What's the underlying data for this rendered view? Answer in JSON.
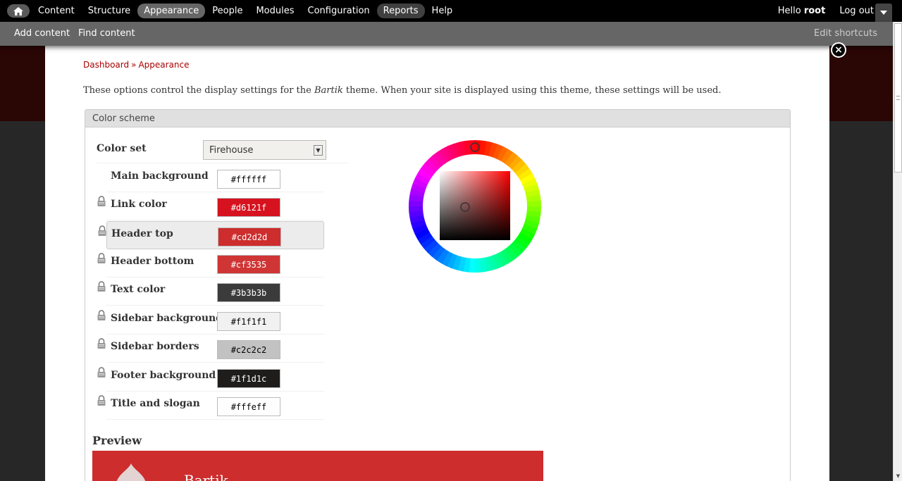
{
  "toolbar": {
    "home_icon": "home-icon",
    "menu": [
      {
        "label": "Content",
        "state": "normal"
      },
      {
        "label": "Structure",
        "state": "normal"
      },
      {
        "label": "Appearance",
        "state": "active"
      },
      {
        "label": "People",
        "state": "normal"
      },
      {
        "label": "Modules",
        "state": "normal"
      },
      {
        "label": "Configuration",
        "state": "normal"
      },
      {
        "label": "Reports",
        "state": "pill"
      },
      {
        "label": "Help",
        "state": "normal"
      }
    ],
    "hello": "Hello",
    "user": "root",
    "logout": "Log out",
    "drawer_icon": "chevron-down-icon"
  },
  "shortcuts": {
    "items": [
      "Add content",
      "Find content"
    ],
    "edit": "Edit shortcuts"
  },
  "overlay": {
    "close_symbol": "×",
    "breadcrumb": [
      "Dashboard",
      "Appearance"
    ],
    "breadcrumb_sep": "»",
    "intro_before": "These options control the display settings for the ",
    "intro_theme": "Bartik",
    "intro_after": " theme. When your site is displayed using this theme, these settings will be used.",
    "color_scheme": {
      "legend": "Color scheme",
      "color_set_label": "Color set",
      "color_set_value": "Firehouse",
      "fields": [
        {
          "label": "Main background",
          "value": "#ffffff",
          "bg": "#ffffff",
          "fg": "#000000",
          "lock": false
        },
        {
          "label": "Link color",
          "value": "#d6121f",
          "bg": "#d6121f",
          "fg": "#ffffff",
          "lock": true
        },
        {
          "label": "Header top",
          "value": "#cd2d2d",
          "bg": "#cd2d2d",
          "fg": "#ffffff",
          "lock": true
        },
        {
          "label": "Header bottom",
          "value": "#cf3535",
          "bg": "#cf3535",
          "fg": "#ffffff",
          "lock": true
        },
        {
          "label": "Text color",
          "value": "#3b3b3b",
          "bg": "#3b3b3b",
          "fg": "#ffffff",
          "lock": true
        },
        {
          "label": "Sidebar background",
          "value": "#f1f1f1",
          "bg": "#f1f1f1",
          "fg": "#000000",
          "lock": true
        },
        {
          "label": "Sidebar borders",
          "value": "#c2c2c2",
          "bg": "#c2c2c2",
          "fg": "#000000",
          "lock": true
        },
        {
          "label": "Footer background",
          "value": "#1f1d1c",
          "bg": "#1f1d1c",
          "fg": "#ffffff",
          "lock": true
        },
        {
          "label": "Title and slogan",
          "value": "#fffeff",
          "bg": "#fffeff",
          "fg": "#000000",
          "lock": true
        }
      ],
      "selected_field": "Header top"
    },
    "preview": {
      "title": "Preview",
      "site_name": "Bartik"
    }
  }
}
